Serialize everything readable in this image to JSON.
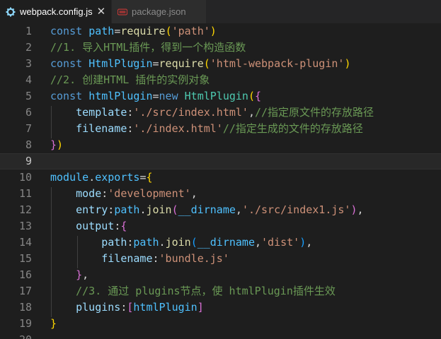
{
  "tabs": [
    {
      "label": "webpack.config.js",
      "icon": "gear-icon",
      "active": true,
      "close": "✕"
    },
    {
      "label": "package.json",
      "icon": "json-file-icon",
      "active": false
    }
  ],
  "colors": {
    "keyword": "#569cd6",
    "variable": "#4fc1ff",
    "function": "#dcdcaa",
    "string": "#ce9178",
    "comment": "#6a9955",
    "property": "#9cdcfe",
    "class": "#4ec9b0",
    "bracket_level1": "#ffd700",
    "bracket_level2": "#da70d6",
    "bracket_level3": "#179fff"
  },
  "lines": [
    {
      "n": "1",
      "tokens": [
        [
          "kw",
          "const "
        ],
        [
          "var",
          "path"
        ],
        [
          "pun",
          "="
        ],
        [
          "fn",
          "require"
        ],
        [
          "br1",
          "("
        ],
        [
          "str",
          "'path'"
        ],
        [
          "br1",
          ")"
        ]
      ]
    },
    {
      "n": "2",
      "tokens": [
        [
          "cmt",
          "//1. 导入HTML插件，得到一个构造函数"
        ]
      ]
    },
    {
      "n": "3",
      "tokens": [
        [
          "kw",
          "const "
        ],
        [
          "var",
          "HtmlPlugin"
        ],
        [
          "pun",
          "="
        ],
        [
          "fn",
          "require"
        ],
        [
          "br1",
          "("
        ],
        [
          "str",
          "'html-webpack-plugin'"
        ],
        [
          "br1",
          ")"
        ]
      ]
    },
    {
      "n": "4",
      "tokens": [
        [
          "cmt",
          "//2. 创建HTML 插件的实例对象"
        ]
      ]
    },
    {
      "n": "5",
      "tokens": [
        [
          "kw",
          "const "
        ],
        [
          "var",
          "htmlPlugin"
        ],
        [
          "pun",
          "="
        ],
        [
          "kw",
          "new "
        ],
        [
          "cls",
          "HtmlPlugin"
        ],
        [
          "br1",
          "("
        ],
        [
          "br2",
          "{"
        ]
      ]
    },
    {
      "n": "6",
      "tokens": [
        [
          "pun",
          "    "
        ],
        [
          "prop",
          "template"
        ],
        [
          "pun",
          ":"
        ],
        [
          "str",
          "'./src/index.html'"
        ],
        [
          "pun",
          ","
        ],
        [
          "cmt",
          "//指定原文件的存放路径"
        ]
      ]
    },
    {
      "n": "7",
      "tokens": [
        [
          "pun",
          "    "
        ],
        [
          "prop",
          "filename"
        ],
        [
          "pun",
          ":"
        ],
        [
          "str",
          "'./index.html'"
        ],
        [
          "cmt",
          "//指定生成的文件的存放路径"
        ]
      ]
    },
    {
      "n": "8",
      "tokens": [
        [
          "br2",
          "}"
        ],
        [
          "br1",
          ")"
        ]
      ]
    },
    {
      "n": "9",
      "tokens": []
    },
    {
      "n": "10",
      "tokens": [
        [
          "var",
          "module"
        ],
        [
          "pun",
          "."
        ],
        [
          "var",
          "exports"
        ],
        [
          "pun",
          "="
        ],
        [
          "br1",
          "{"
        ]
      ]
    },
    {
      "n": "11",
      "tokens": [
        [
          "pun",
          "    "
        ],
        [
          "prop",
          "mode"
        ],
        [
          "pun",
          ":"
        ],
        [
          "str",
          "'development'"
        ],
        [
          "pun",
          ","
        ]
      ]
    },
    {
      "n": "12",
      "tokens": [
        [
          "pun",
          "    "
        ],
        [
          "prop",
          "entry"
        ],
        [
          "pun",
          ":"
        ],
        [
          "var",
          "path"
        ],
        [
          "pun",
          "."
        ],
        [
          "fn",
          "join"
        ],
        [
          "br2",
          "("
        ],
        [
          "var",
          "__dirname"
        ],
        [
          "pun",
          ","
        ],
        [
          "str",
          "'./src/index1.js'"
        ],
        [
          "br2",
          ")"
        ],
        [
          "pun",
          ","
        ]
      ]
    },
    {
      "n": "13",
      "tokens": [
        [
          "pun",
          "    "
        ],
        [
          "prop",
          "output"
        ],
        [
          "pun",
          ":"
        ],
        [
          "br2",
          "{"
        ]
      ]
    },
    {
      "n": "14",
      "tokens": [
        [
          "pun",
          "        "
        ],
        [
          "prop",
          "path"
        ],
        [
          "pun",
          ":"
        ],
        [
          "var",
          "path"
        ],
        [
          "pun",
          "."
        ],
        [
          "fn",
          "join"
        ],
        [
          "br3",
          "("
        ],
        [
          "var",
          "__dirname"
        ],
        [
          "pun",
          ","
        ],
        [
          "str",
          "'dist'"
        ],
        [
          "br3",
          ")"
        ],
        [
          "pun",
          ","
        ]
      ]
    },
    {
      "n": "15",
      "tokens": [
        [
          "pun",
          "        "
        ],
        [
          "prop",
          "filename"
        ],
        [
          "pun",
          ":"
        ],
        [
          "str",
          "'bundle.js'"
        ]
      ]
    },
    {
      "n": "16",
      "tokens": [
        [
          "pun",
          "    "
        ],
        [
          "br2",
          "}"
        ],
        [
          "pun",
          ","
        ]
      ]
    },
    {
      "n": "17",
      "tokens": [
        [
          "pun",
          "    "
        ],
        [
          "cmt",
          "//3. 通过 plugins节点，使 htmlPlugin插件生效"
        ]
      ]
    },
    {
      "n": "18",
      "tokens": [
        [
          "pun",
          "    "
        ],
        [
          "prop",
          "plugins"
        ],
        [
          "pun",
          ":"
        ],
        [
          "br2",
          "["
        ],
        [
          "var",
          "htmlPlugin"
        ],
        [
          "br2",
          "]"
        ]
      ]
    },
    {
      "n": "19",
      "tokens": [
        [
          "br1",
          "}"
        ]
      ]
    },
    {
      "n": "20",
      "tokens": []
    }
  ],
  "current_line": "9"
}
